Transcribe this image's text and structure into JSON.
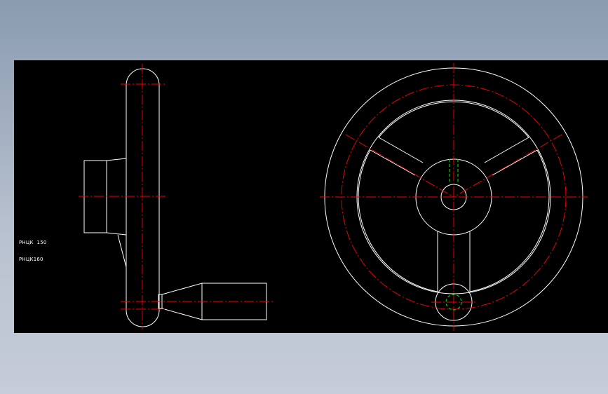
{
  "labels": {
    "part_a": "РНЦК  150",
    "part_b": "РНЦК160"
  },
  "colors": {
    "background": "#000000",
    "outline": "#ffffff",
    "centerline": "#ff0000",
    "hidden": "#00cc00",
    "frame_gradient_top": "#8a9bb0",
    "frame_gradient_bottom": "#c6ccd8"
  }
}
